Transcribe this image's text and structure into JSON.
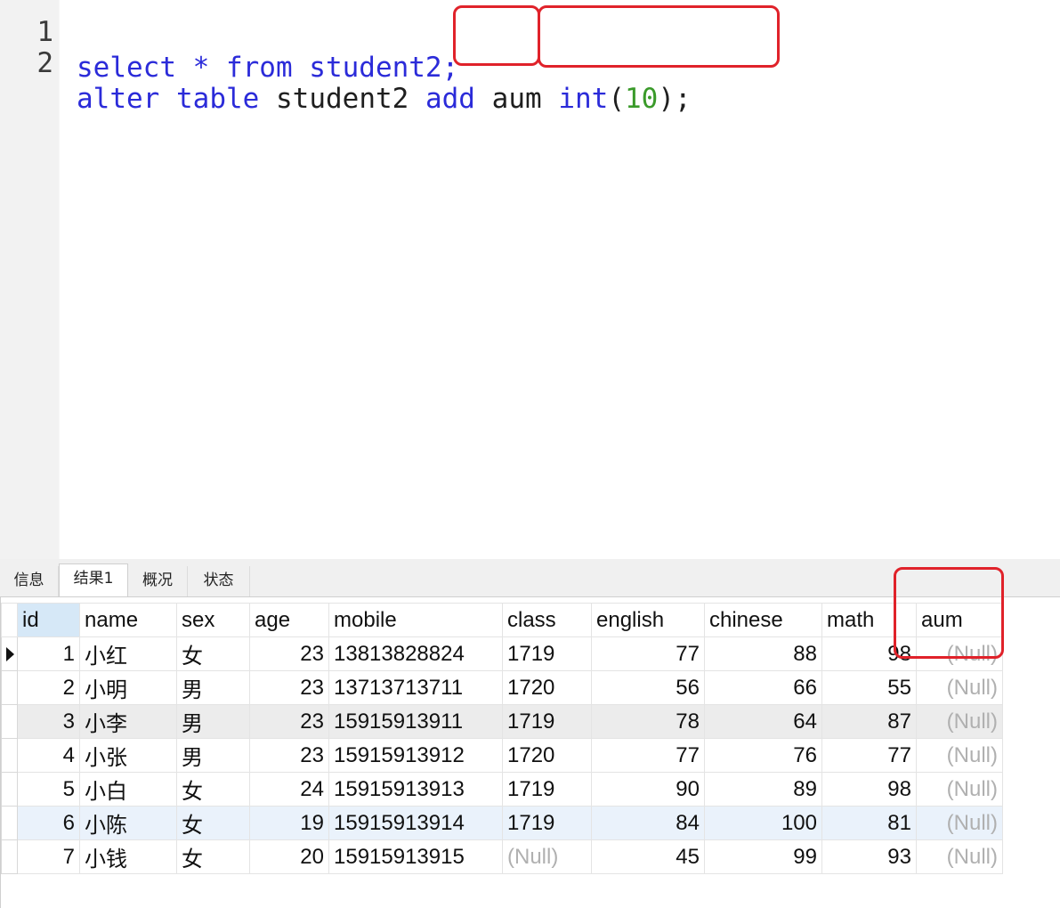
{
  "editor": {
    "line1": {
      "number": "1",
      "text": "select * from student2;"
    },
    "line2": {
      "number": "2",
      "kw_alter": "alter",
      "kw_table": "table",
      "table_name": "student2",
      "kw_add": "add",
      "column_name": "aum",
      "kw_int": "int",
      "paren_open": "(",
      "length": "10",
      "paren_close_semicolon": ");"
    }
  },
  "tabs": [
    {
      "label": "信息"
    },
    {
      "label": "结果1"
    },
    {
      "label": "概况"
    },
    {
      "label": "状态"
    }
  ],
  "grid": {
    "columns": [
      "id",
      "name",
      "sex",
      "age",
      "mobile",
      "class",
      "english",
      "chinese",
      "math",
      "aum"
    ],
    "rows": [
      [
        "1",
        "小红",
        "女",
        "23",
        "13813828824",
        "1719",
        "77",
        "88",
        "98",
        "(Null)"
      ],
      [
        "2",
        "小明",
        "男",
        "23",
        "13713713711",
        "1720",
        "56",
        "66",
        "55",
        "(Null)"
      ],
      [
        "3",
        "小李",
        "男",
        "23",
        "15915913911",
        "1719",
        "78",
        "64",
        "87",
        "(Null)"
      ],
      [
        "4",
        "小张",
        "男",
        "23",
        "15915913912",
        "1720",
        "77",
        "76",
        "77",
        "(Null)"
      ],
      [
        "5",
        "小白",
        "女",
        "24",
        "15915913913",
        "1719",
        "90",
        "89",
        "98",
        "(Null)"
      ],
      [
        "6",
        "小陈",
        "女",
        "19",
        "15915913914",
        "1719",
        "84",
        "100",
        "81",
        "(Null)"
      ],
      [
        "7",
        "小钱",
        "女",
        "20",
        "15915913915",
        "(Null)",
        "45",
        "99",
        "93",
        "(Null)"
      ]
    ]
  },
  "colors": {
    "keyword": "#2b2bd9",
    "number": "#3a9a2a",
    "highlight_box": "#e0222a",
    "null_text": "#b0b0b0",
    "selected_header": "#d6e8f7"
  },
  "icons": {
    "current_row_indicator": "triangle-right-icon"
  }
}
